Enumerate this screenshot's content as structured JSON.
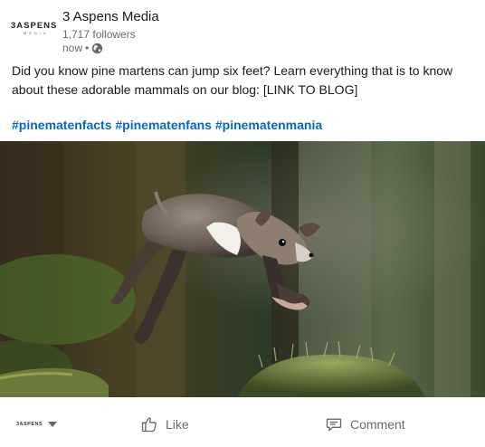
{
  "header": {
    "logo": {
      "main": "3ASPENS",
      "sub": "MEDIA"
    },
    "company_name": "3 Aspens Media",
    "followers": "1,717 followers",
    "timestamp": "now",
    "separator": "•",
    "visibility_icon": "globe-icon"
  },
  "post": {
    "text": "Did you know pine martens can jump six feet? Learn everything that is to know about these adorable mammals on our blog: [LINK TO BLOG]",
    "hashtags": [
      "#pinematenfacts",
      "#pinematenfans",
      "#pinematenmania"
    ],
    "image_subject": "pine marten leaping over mossy log",
    "link_color": "#0a66c2"
  },
  "actions": {
    "actor_logo": "3ASPENS",
    "actor_caret": "caret-down-icon",
    "like_label": "Like",
    "like_icon": "thumbs-up-icon",
    "comment_label": "Comment",
    "comment_icon": "speech-bubble-icon"
  }
}
